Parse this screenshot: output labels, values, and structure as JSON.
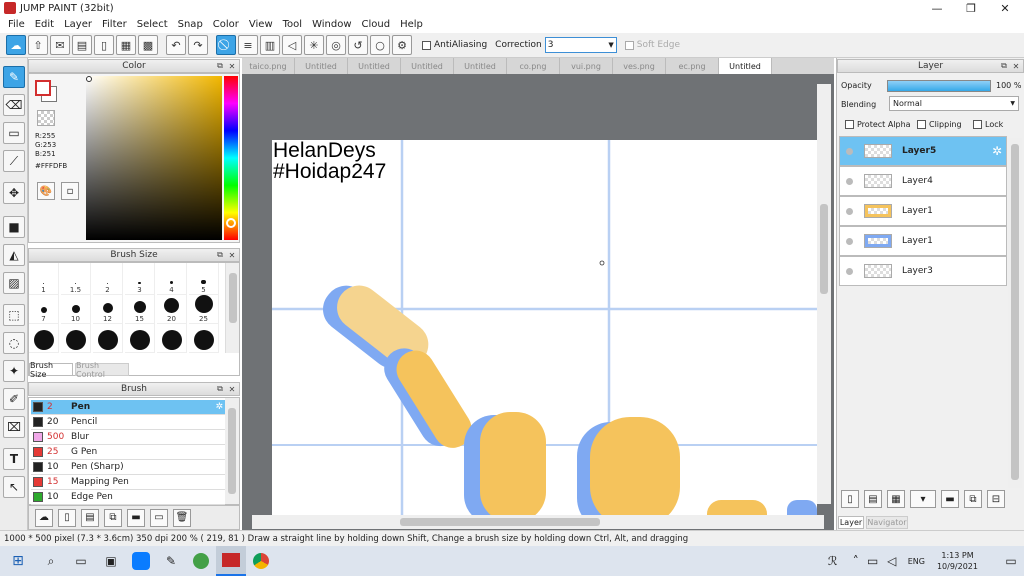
{
  "window": {
    "title": "JUMP PAINT (32bit)",
    "min": "—",
    "max": "❐",
    "close": "✕"
  },
  "menu": [
    "File",
    "Edit",
    "Layer",
    "Filter",
    "Select",
    "Snap",
    "Color",
    "View",
    "Tool",
    "Window",
    "Cloud",
    "Help"
  ],
  "toolbar": {
    "antialiasing": "AntiAliasing",
    "correction_label": "Correction",
    "correction_value": "3",
    "soft_edge": "Soft Edge"
  },
  "color_panel": {
    "title": "Color",
    "r": "R:255",
    "g": "G:253",
    "b": "B:251",
    "hex": "#FFFDFB",
    "fg": "#ffffff",
    "bg": "#ffffff"
  },
  "brush_size": {
    "title": "Brush Size",
    "tab1": "Brush Size",
    "tab2": "Brush Control",
    "rows": [
      [
        "1",
        "1.5",
        "2",
        "3",
        "4",
        "5"
      ],
      [
        "7",
        "10",
        "12",
        "15",
        "20",
        "25"
      ],
      [
        "",
        "",
        "",
        "",
        "",
        ""
      ]
    ]
  },
  "brush": {
    "title": "Brush",
    "items": [
      {
        "num": "2",
        "name": "Pen",
        "color": "#222222"
      },
      {
        "num": "20",
        "name": "Pencil",
        "color": "#222222"
      },
      {
        "num": "500",
        "name": "Blur",
        "color": "#f0a8e8"
      },
      {
        "num": "25",
        "name": "G Pen",
        "color": "#e53935"
      },
      {
        "num": "10",
        "name": "Pen (Sharp)",
        "color": "#222222"
      },
      {
        "num": "15",
        "name": "Mapping Pen",
        "color": "#e53935"
      },
      {
        "num": "10",
        "name": "Edge Pen",
        "color": "#2eaa2e"
      }
    ]
  },
  "tabs": [
    "taico.png",
    "Untitled",
    "Untitled",
    "Untitled",
    "Untitled",
    "co.png",
    "vui.png",
    "ves.png",
    "ec.png",
    "Untitled"
  ],
  "canvas": {
    "text1": "HelanDeys",
    "text2": "#Hoidap247"
  },
  "layer_panel": {
    "title": "Layer",
    "opacity_label": "Opacity",
    "opacity_value": "100 %",
    "opacity": 1.0,
    "blending_label": "Blending",
    "blending_value": "Normal",
    "protect": "Protect Alpha",
    "clipping": "Clipping",
    "lock": "Lock",
    "layers": [
      "Layer5",
      "Layer4",
      "Layer1",
      "Layer1",
      "Layer3"
    ],
    "tab_layer": "Layer",
    "tab_navigator": "Navigator"
  },
  "status": {
    "text": "1000 * 500 pixel  (7.3 * 3.6cm)  350 dpi  200 %  ( 219, 81 )  Draw a straight line by holding down Shift, Change a brush size by holding down Ctrl, Alt, and dragging"
  },
  "taskbar": {
    "time": "1:13 PM",
    "date": "10/9/2021",
    "lang": "ENG"
  }
}
